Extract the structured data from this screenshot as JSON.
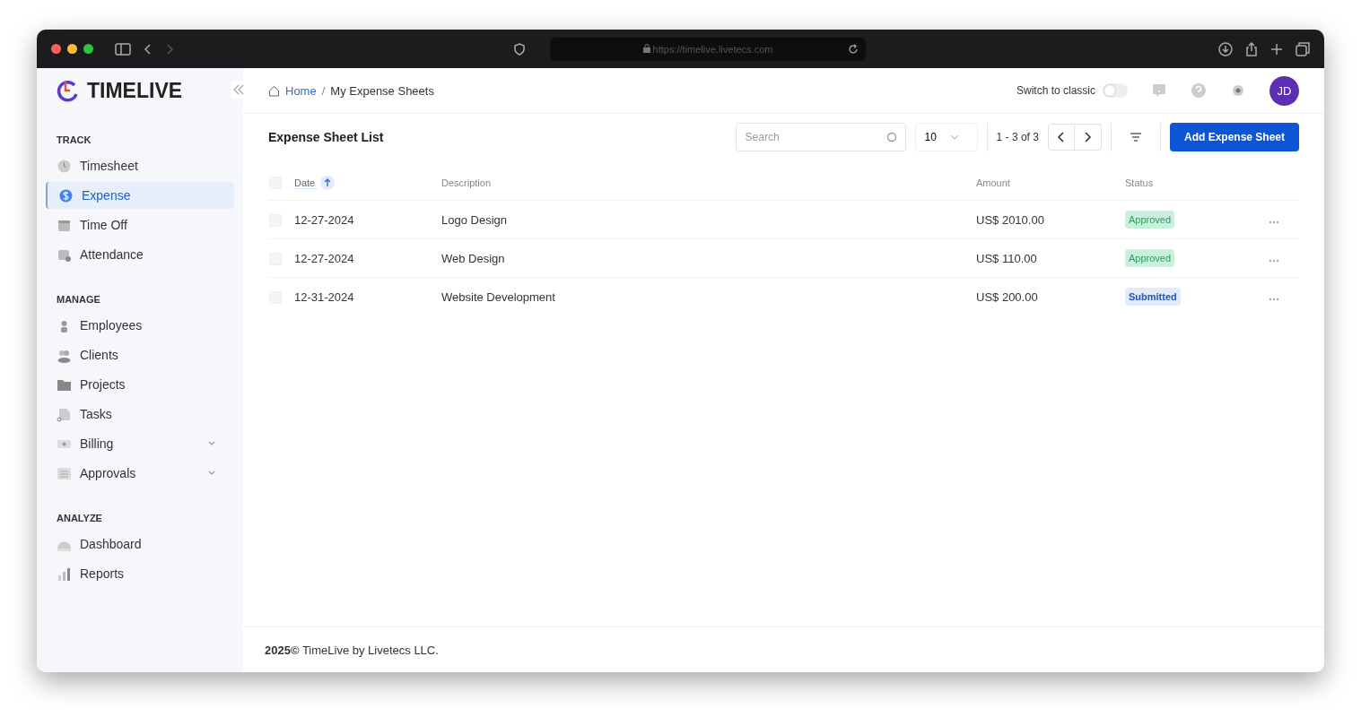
{
  "browser": {
    "url": "https://timelive.livetecs.com"
  },
  "brand": {
    "name": "TIMELIVE"
  },
  "breadcrumb_separator": "/",
  "breadcrumb": [
    {
      "label": "Home",
      "kind": "link"
    },
    {
      "label": "My Expense Sheets",
      "kind": "current"
    }
  ],
  "header": {
    "switch_label": "Switch to classic",
    "switch_on": false,
    "avatar": "JD"
  },
  "sidebar": {
    "sections": [
      {
        "title": "TRACK",
        "items": [
          {
            "label": "Timesheet",
            "selected": false,
            "expandable": false
          },
          {
            "label": "Expense",
            "selected": true,
            "expandable": false
          },
          {
            "label": "Time Off",
            "selected": false,
            "expandable": false
          },
          {
            "label": "Attendance",
            "selected": false,
            "expandable": false
          }
        ]
      },
      {
        "title": "MANAGE",
        "items": [
          {
            "label": "Employees",
            "selected": false,
            "expandable": false
          },
          {
            "label": "Clients",
            "selected": false,
            "expandable": false
          },
          {
            "label": "Projects",
            "selected": false,
            "expandable": false
          },
          {
            "label": "Tasks",
            "selected": false,
            "expandable": false
          },
          {
            "label": "Billing",
            "selected": false,
            "expandable": true
          },
          {
            "label": "Approvals",
            "selected": false,
            "expandable": true
          }
        ]
      },
      {
        "title": "ANALYZE",
        "items": [
          {
            "label": "Dashboard",
            "selected": false,
            "expandable": false
          },
          {
            "label": "Reports",
            "selected": false,
            "expandable": false
          }
        ]
      }
    ]
  },
  "list": {
    "title": "Expense Sheet List",
    "search": {
      "placeholder": "Search"
    },
    "page_size": "10",
    "range": "1 - 3 of 3",
    "add_button": "Add Expense Sheet"
  },
  "table": {
    "all_checked": false,
    "columns": [
      {
        "label": "Date",
        "sorted": true
      },
      {
        "label": "Description",
        "sorted": false
      },
      {
        "label": "Amount",
        "sorted": false
      },
      {
        "label": "Status",
        "sorted": false
      }
    ],
    "rows": [
      {
        "checked": false,
        "date": "12-27-2024",
        "description": "Logo Design",
        "amount": "US$ 2010.00",
        "status": "Approved",
        "kind": "approved"
      },
      {
        "checked": false,
        "date": "12-27-2024",
        "description": "Web Design",
        "amount": "US$ 110.00",
        "status": "Approved",
        "kind": "approved"
      },
      {
        "checked": false,
        "date": "12-31-2024",
        "description": "Website Development",
        "amount": "US$ 200.00",
        "status": "Submitted",
        "kind": "submitted"
      }
    ]
  },
  "footer": {
    "text": "**2025©** TimeLive by Livetecs LLC."
  }
}
